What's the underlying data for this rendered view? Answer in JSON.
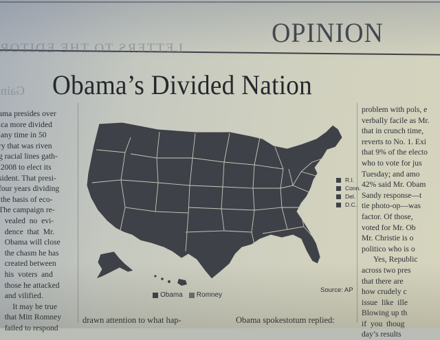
{
  "section_title": "OPINION",
  "reversed_header": "LETTERS TO THE EDITOR",
  "reversed_fragment": "Gains",
  "headline": "Obama’s Divided Nation",
  "left_column_lines": [
    "ama presides over",
    "ica more divided",
    " any time in 50",
    "ry that was riven",
    "g racial lines gath-",
    " 2008 to elect its",
    "sident. That presi-",
    "four years dividing",
    " the basis of eco-",
    "The campaign re-",
    "   vealed  no  evi-",
    "   dence  that  Mr.",
    "   Obama will close",
    "   the chasm he has",
    "   created between",
    "   his  voters  and",
    "   those he attacked",
    "   and vilified.",
    "       It may be true",
    "   that Mitt Romney",
    "   failed to respond"
  ],
  "right_column_lines": [
    "problem with pols, e",
    "verbally facile as Mr.",
    "that in crunch time,",
    "reverts to No. 1. Exi",
    "that 9% of the electo",
    "who to vote for jus",
    "Tuesday; and amo",
    "42% said Mr. Obam",
    "Sandy response—t",
    "tie photo-op—was",
    "factor. Of those,",
    "voted for Mr. Ob",
    "Mr. Christie is o",
    "politico who is o",
    "      Yes, Republic",
    "across two pres",
    "that there are",
    "how crudely c",
    "issue  like  ille",
    "Blowing up th",
    "if  you  thoug",
    "day’s results"
  ],
  "bottom_middle": "drawn attention to what hap-",
  "bottom_right": "Obama   spokestotum   replied:",
  "map": {
    "small_state_legend": [
      {
        "abbr": "R.I.",
        "party": "Obama"
      },
      {
        "abbr": "Conn.",
        "party": "Obama"
      },
      {
        "abbr": "Del.",
        "party": "Obama"
      },
      {
        "abbr": "D.C.",
        "party": "Obama"
      }
    ],
    "legend": [
      {
        "label": "Obama",
        "color": "#3e4147"
      },
      {
        "label": "Romney",
        "color": "#6b6e73"
      }
    ],
    "source": "Source: AP",
    "colors": {
      "obama": "#3e4147",
      "romney": "#5e6166",
      "border": "#c9cabd"
    }
  }
}
